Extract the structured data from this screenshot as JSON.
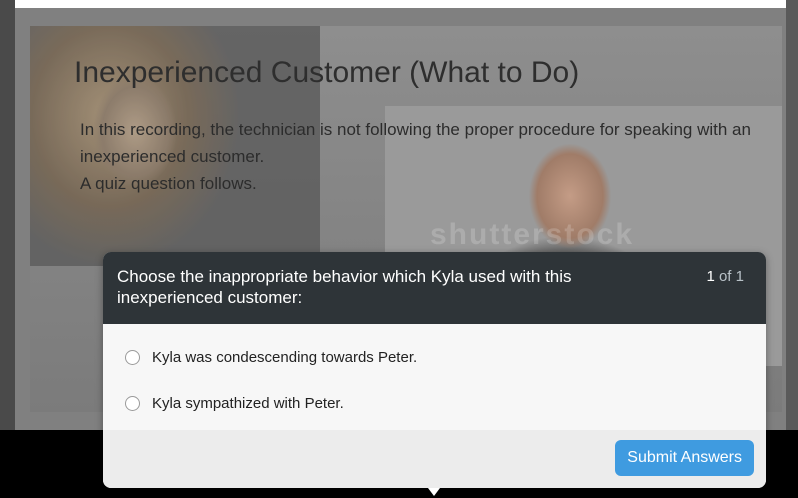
{
  "slide": {
    "title": "Inexperienced Customer (What to Do)",
    "paragraph_1": "In this recording, the technician is not following the proper procedure for speaking with an inexperienced customer.",
    "paragraph_2": "A quiz question follows.",
    "watermark": "shutterstock"
  },
  "quiz": {
    "question": "Choose the inappropriate behavior which Kyla used with this inexperienced customer:",
    "current": "1",
    "of_total": "of 1",
    "options": [
      {
        "label": "Kyla was condescending towards Peter."
      },
      {
        "label": "Kyla sympathized with Peter."
      }
    ],
    "submit_label": "Submit Answers"
  },
  "colors": {
    "header": "#2e3438",
    "submit": "#3f9be0"
  }
}
